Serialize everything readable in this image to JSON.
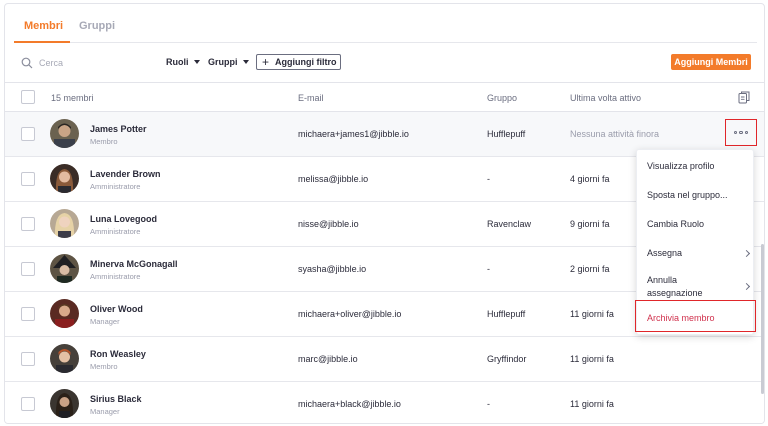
{
  "tabs": [
    {
      "label": "Membri",
      "active": true
    },
    {
      "label": "Gruppi",
      "active": false
    }
  ],
  "search": {
    "placeholder": "Cerca"
  },
  "filters": {
    "roles": "Ruoli",
    "groups": "Gruppi",
    "add_filter": "Aggiungi filtro"
  },
  "add_members_label": "Aggiungi Membri",
  "table": {
    "headers": {
      "count": "15 membri",
      "email": "E-mail",
      "group": "Gruppo",
      "last_active": "Ultima volta attivo"
    },
    "rows": [
      {
        "name": "James Potter",
        "role": "Membro",
        "email": "michaera+james1@jibble.io",
        "group": "Hufflepuff",
        "last_active": "Nessuna attività finora"
      },
      {
        "name": "Lavender Brown",
        "role": "Amministratore",
        "email": "melissa@jibble.io",
        "group": "-",
        "last_active": "4 giorni fa"
      },
      {
        "name": "Luna Lovegood",
        "role": "Amministratore",
        "email": "nisse@jibble.io",
        "group": "Ravenclaw",
        "last_active": "9 giorni fa"
      },
      {
        "name": "Minerva McGonagall",
        "role": "Amministratore",
        "email": "syasha@jibble.io",
        "group": "-",
        "last_active": "2 giorni fa"
      },
      {
        "name": "Oliver Wood",
        "role": "Manager",
        "email": "michaera+oliver@jibble.io",
        "group": "Hufflepuff",
        "last_active": "11 giorni fa"
      },
      {
        "name": "Ron Weasley",
        "role": "Membro",
        "email": "marc@jibble.io",
        "group": "Gryffindor",
        "last_active": "11 giorni fa"
      },
      {
        "name": "Sirius Black",
        "role": "Manager",
        "email": "michaera+black@jibble.io",
        "group": "-",
        "last_active": "11 giorni fa"
      }
    ]
  },
  "menu": {
    "view_profile": "Visualizza profilo",
    "move_group": "Sposta nel gruppo...",
    "change_role": "Cambia Ruolo",
    "assign": "Assegna",
    "unassign_line1": "Annulla",
    "unassign_line2": "assegnazione",
    "archive": "Archivia membro"
  },
  "colors": {
    "accent": "#f37b2a",
    "danger": "#d0314d",
    "highlight": "#e0262a"
  }
}
